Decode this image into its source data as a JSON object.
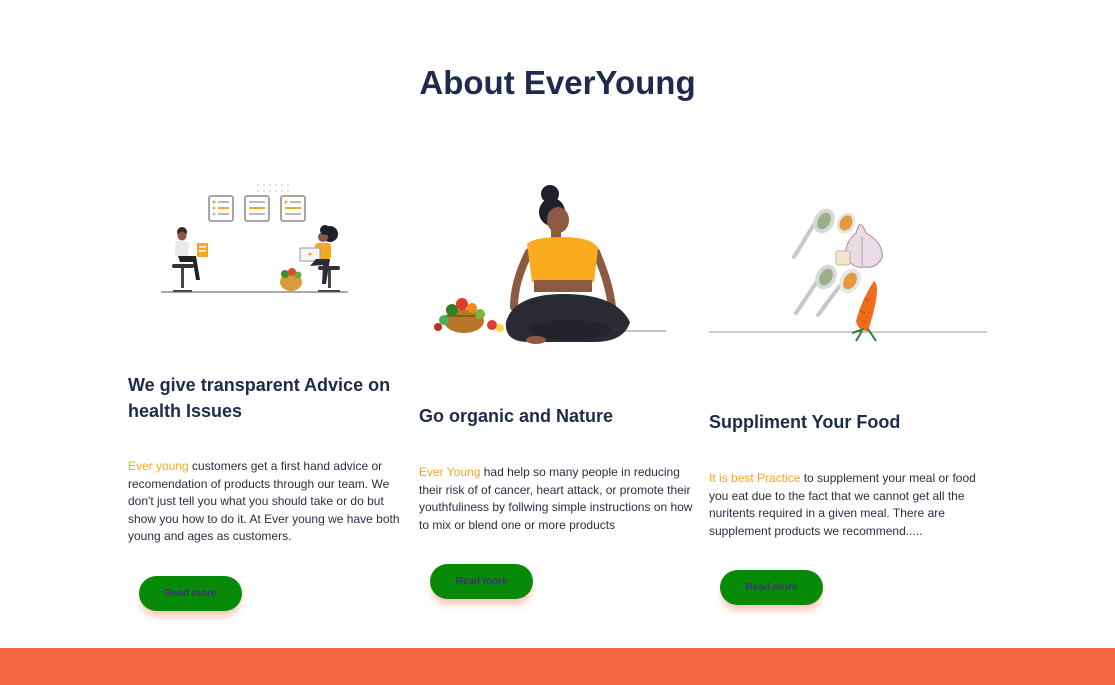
{
  "page": {
    "title": "About EverYoung"
  },
  "cards": [
    {
      "heading": "We give transparent Advice on health Issues",
      "highlight": "Ever young",
      "body": " customers get a first hand advice or recomendation of products through our team. We don't just tell you what you should take or do but show you how to do it. At Ever young we have both young and ages as customers.",
      "button": "Read more",
      "illustration": "consultation-icon"
    },
    {
      "heading": "Go organic and Nature",
      "highlight": "Ever Young",
      "body": " had help so many people in reducing their risk of of cancer, heart attack, or promote their youthfuliness by follwing simple instructions on how to mix or blend one or more products",
      "button": "Read more",
      "illustration": "yoga-meditation-icon"
    },
    {
      "heading": "Suppliment Your Food",
      "highlight": "It is best Practice",
      "body": " to supplement your meal or food you eat due to the fact that we cannot get all the nuritents required in a given meal. There are supplement products we recommend.....",
      "button": "Read more",
      "illustration": "spices-vegetables-icon"
    }
  ],
  "colors": {
    "heading": "#1f2a4d",
    "highlight": "#f5a623",
    "button_bg": "#078a07",
    "footer_band": "#f26641"
  }
}
